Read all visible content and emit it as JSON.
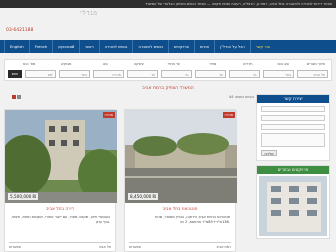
{
  "topbar": {
    "text": "מבחר דירות למכירה ולהשכרה בתל אביב, רמת גן, הרצליה, רעננה ופתח תקווה — מבחר נכסים בשיווק הבלעדי של המשרד"
  },
  "header": {
    "logo": "מגדלי",
    "phone": "03-6421188"
  },
  "nav": {
    "items": [
      "English",
      "French",
      "русский",
      "ראשי",
      "נכסים למכירה",
      "נכסים להשכרה",
      "פרויקטים",
      "אודות",
      "הכל על הנדל\"ן",
      "צור קשר"
    ]
  },
  "search": {
    "labels": [
      "איזור מגורים",
      "סוג נכס",
      "חדרים",
      "מחיר",
      "עד מחיר",
      "עיסקה",
      "סוג",
      "מבוקש",
      "מס' נכס"
    ],
    "fields": [
      "תל אביב",
      "בחר",
      "מ-",
      "עד",
      "מ-",
      "עד",
      "מכירה",
      "בחר",
      "מס'"
    ],
    "button": "חפש"
  },
  "city_title": "המשרד הוותיק ברמת אביב",
  "results_count": "44 נכסים נמצאו",
  "listings": [
    {
      "tag": "מכירה",
      "price": "5,500,000 ₪",
      "title": "דירה בתל אביב",
      "desc": "בעוספיי חיזה, שקטה מאוד, עם ייעור אחורי, ושקשת תוחת, חיצוני, ונוף ענק.",
      "city": "תל אביב",
      "rooms": "אפשרות"
    },
    {
      "tag": "מכירה",
      "price": "8,450,000 ₪",
      "title": "פנטהאוז בתל אביב",
      "desc": "פנטהאוז ברמת אביב הירוקה, בבניין מפואר, שטח 136מ\"ר+85מ\"ר מרפסת, 2 חנ.",
      "city": "רמת אביב",
      "rooms": "אפשרות"
    }
  ],
  "sidebar": {
    "contact_title": "יצירת קשר",
    "send_label": "שליחה",
    "projects_title": "פרויקטים נבחרים"
  },
  "colors": {
    "nav": "#0f4e8d",
    "accent": "#c0392b",
    "green": "#3e8e41"
  }
}
